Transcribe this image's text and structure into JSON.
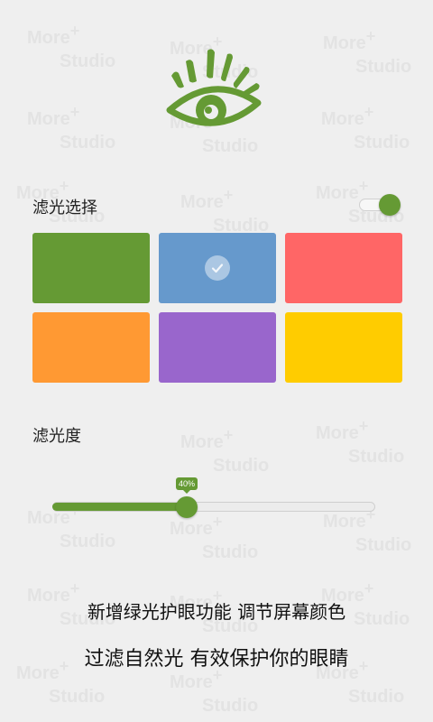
{
  "watermark": {
    "line1": "More",
    "plus": "+",
    "line2": "Studio"
  },
  "filter": {
    "title": "滤光选择",
    "enabled": true,
    "colors": [
      {
        "name": "green",
        "hex": "#659a34",
        "selected": false
      },
      {
        "name": "blue",
        "hex": "#6699cc",
        "selected": true
      },
      {
        "name": "red",
        "hex": "#ff6666",
        "selected": false
      },
      {
        "name": "orange",
        "hex": "#ff9933",
        "selected": false
      },
      {
        "name": "purple",
        "hex": "#9966cc",
        "selected": false
      },
      {
        "name": "yellow",
        "hex": "#ffcc00",
        "selected": false
      }
    ]
  },
  "intensity": {
    "title": "滤光度",
    "value": 40,
    "value_label": "40%"
  },
  "captions": {
    "line1": "新增绿光护眼功能 调节屏幕颜色",
    "line2": "过滤自然光 有效保护你的眼睛"
  },
  "colors": {
    "accent": "#659a34",
    "watermark": "#e3e3e3"
  },
  "icons": {
    "logo": "eye-icon",
    "selected": "check-icon"
  }
}
